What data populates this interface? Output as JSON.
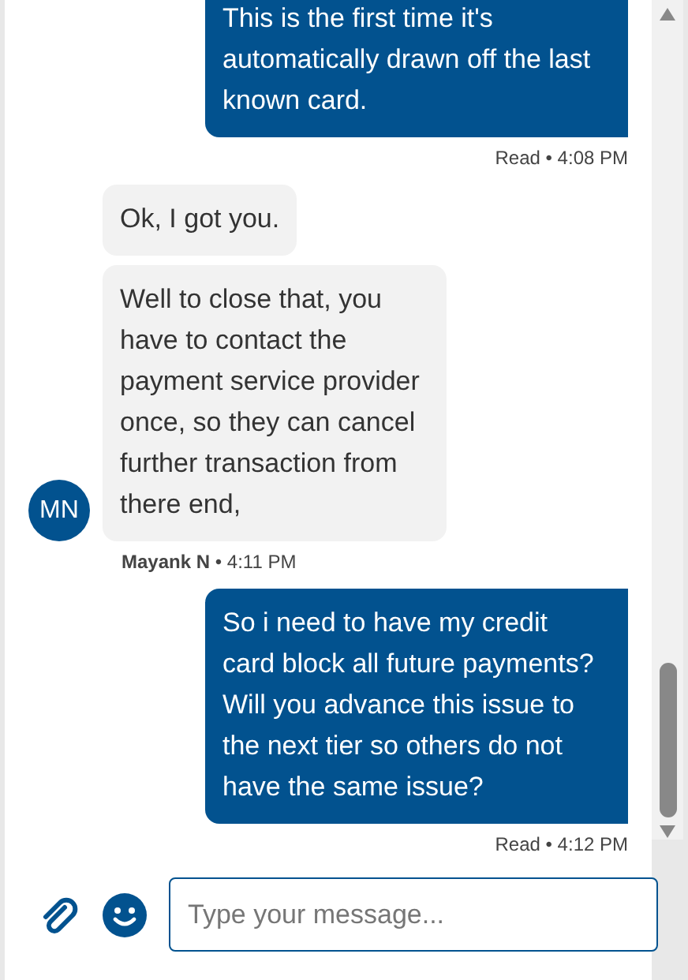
{
  "messages": [
    {
      "kind": "user",
      "bubbles": [
        "This is the first time it's automatically drawn off the last known card."
      ],
      "meta": "Read • 4:08 PM"
    },
    {
      "kind": "agent",
      "avatar": "MN",
      "bubbles": [
        "Ok, I got you.",
        "Well to close that, you have to contact the payment service provider once, so they can cancel further transaction from there end,"
      ],
      "meta": "**Mayank N** • 4:11 PM"
    },
    {
      "kind": "user",
      "bubbles": [
        "So i need to have my credit card block all future payments? Will you advance this issue to the next tier so others do not have the same issue?"
      ],
      "meta": "Read • 4:12 PM"
    }
  ],
  "composer": {
    "placeholder": "Type your message..."
  }
}
